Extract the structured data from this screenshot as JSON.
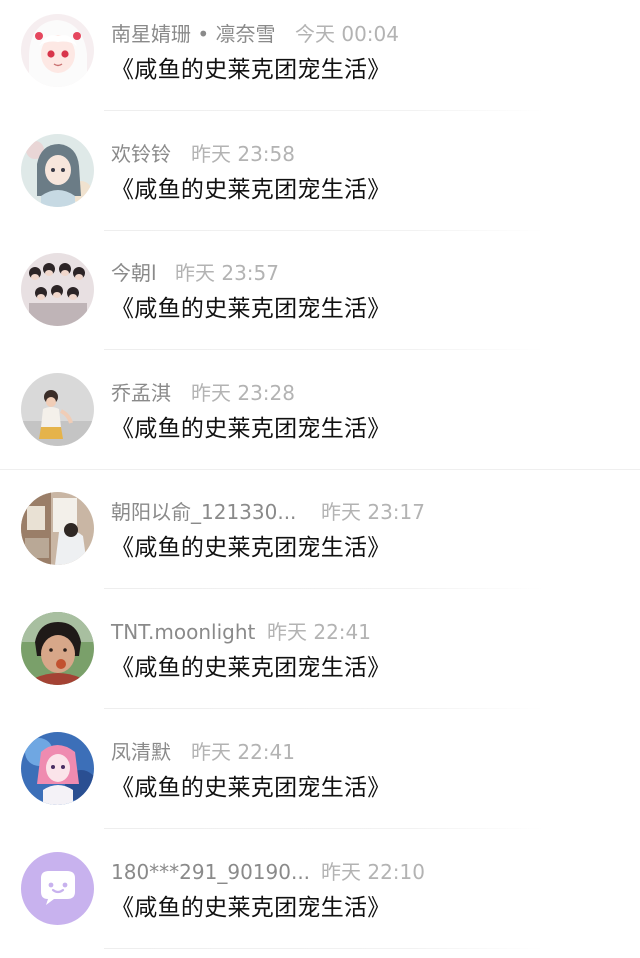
{
  "comments": [
    {
      "name": "南星婧珊 • 凛奈雪",
      "time": "今天 00:04",
      "text": "《咸鱼的史莱克团宠生活》"
    },
    {
      "name": "欢铃铃",
      "time": "昨天 23:58",
      "text": "《咸鱼的史莱克团宠生活》"
    },
    {
      "name": "今朝l",
      "time": "昨天 23:57",
      "text": "《咸鱼的史莱克团宠生活》"
    },
    {
      "name": "乔孟淇",
      "time": "昨天 23:28",
      "text": "《咸鱼的史莱克团宠生活》"
    },
    {
      "name": "朝阳以俞_121330...",
      "time": "昨天 23:17",
      "text": "《咸鱼的史莱克团宠生活》"
    },
    {
      "name": "TNT.moonlight",
      "time": "昨天 22:41",
      "text": "《咸鱼的史莱克团宠生活》"
    },
    {
      "name": "凤清默",
      "time": "昨天 22:41",
      "text": "《咸鱼的史莱克团宠生活》"
    },
    {
      "name": "180***291_90190...",
      "time": "昨天 22:10",
      "text": "《咸鱼的史莱克团宠生活》"
    }
  ],
  "colors": {
    "name": "#8a8a8a",
    "time": "#b3b3b3",
    "message": "#111111",
    "default_avatar": "#c8b2ee"
  },
  "icons": [
    "anime-girl-avatar-icon",
    "illustrated-girl-avatar-icon",
    "group-photo-avatar-icon",
    "child-photo-avatar-icon",
    "room-photo-avatar-icon",
    "person-photo-avatar-icon",
    "anime-character-avatar-icon",
    "default-chat-bubble-avatar-icon"
  ]
}
